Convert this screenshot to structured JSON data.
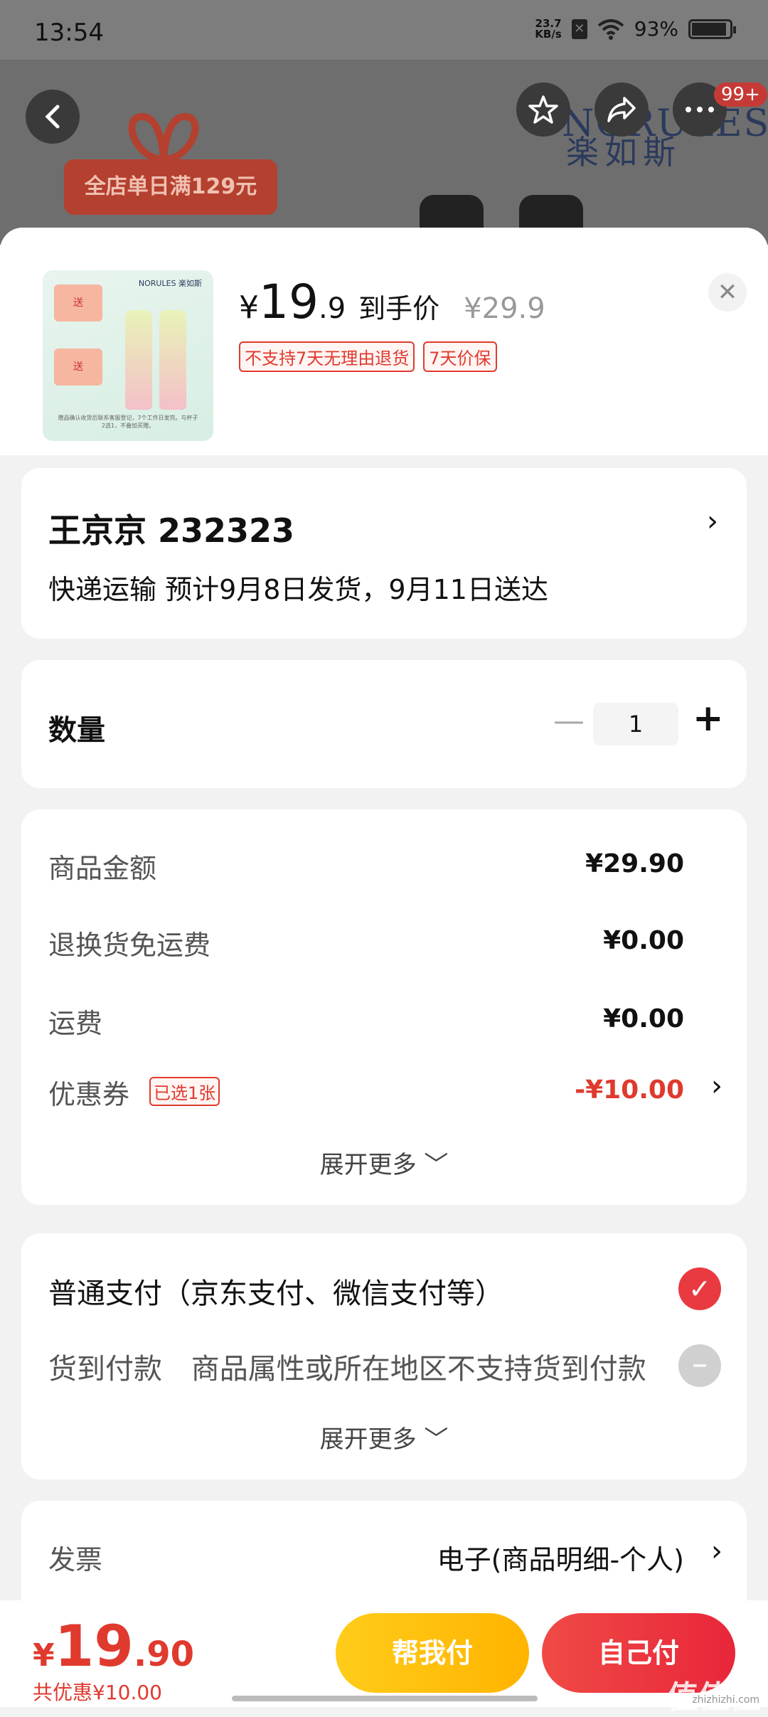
{
  "status_bar": {
    "time": "13:54",
    "speed": "23.7",
    "speed_unit": "KB/s",
    "battery": "93%",
    "battery_level": 0.93
  },
  "backdrop": {
    "brand_logo": "NORULES",
    "brand_cn": "楽如斯",
    "badge": "99+",
    "promo": "全店单日满129元"
  },
  "product": {
    "price_yen": "¥",
    "price_int": "19",
    "price_dec": ".9",
    "price_label": "到手价",
    "original_price": "¥29.9",
    "tags": [
      "不支持7天无理由退货",
      "7天价保"
    ],
    "thumb_logo": "NORULES 楽如斯",
    "thumb_tag_top": "送",
    "thumb_tag_bottom": "送",
    "thumb_note": "赠品确认收货后联系客服登记，7个工作日发完。与杯子2选1，不叠加买赠。"
  },
  "address": {
    "name_line": "王京京  232323",
    "shipping": "快递运输 预计9月8日发货，9月11日送达"
  },
  "quantity": {
    "label": "数量",
    "value": "1"
  },
  "costs": {
    "rows": [
      {
        "label": "商品金额",
        "value": "¥29.90"
      },
      {
        "label": "退换货免运费",
        "value": "¥0.00"
      },
      {
        "label": "运费",
        "value": "¥0.00"
      },
      {
        "label": "优惠券",
        "tag": "已选1张",
        "value": "-¥10.00"
      }
    ],
    "expand": "展开更多 ﹀"
  },
  "payment": {
    "normal_label": "普通支付（京东支付、微信支付等）",
    "cod_label": "货到付款",
    "cod_note": "商品属性或所在地区不支持货到付款",
    "expand": "展开更多 ﹀"
  },
  "invoice": {
    "label": "发票",
    "value": "电子(商品明细-个人)"
  },
  "bottom": {
    "total_yen": "¥",
    "total_int": "19",
    "total_dec": ".90",
    "discount": "共优惠¥10.00",
    "help_pay": "帮我付",
    "self_pay": "自己付"
  },
  "watermark": {
    "main": "值值值",
    "sub": "zhizhizhi.com"
  }
}
